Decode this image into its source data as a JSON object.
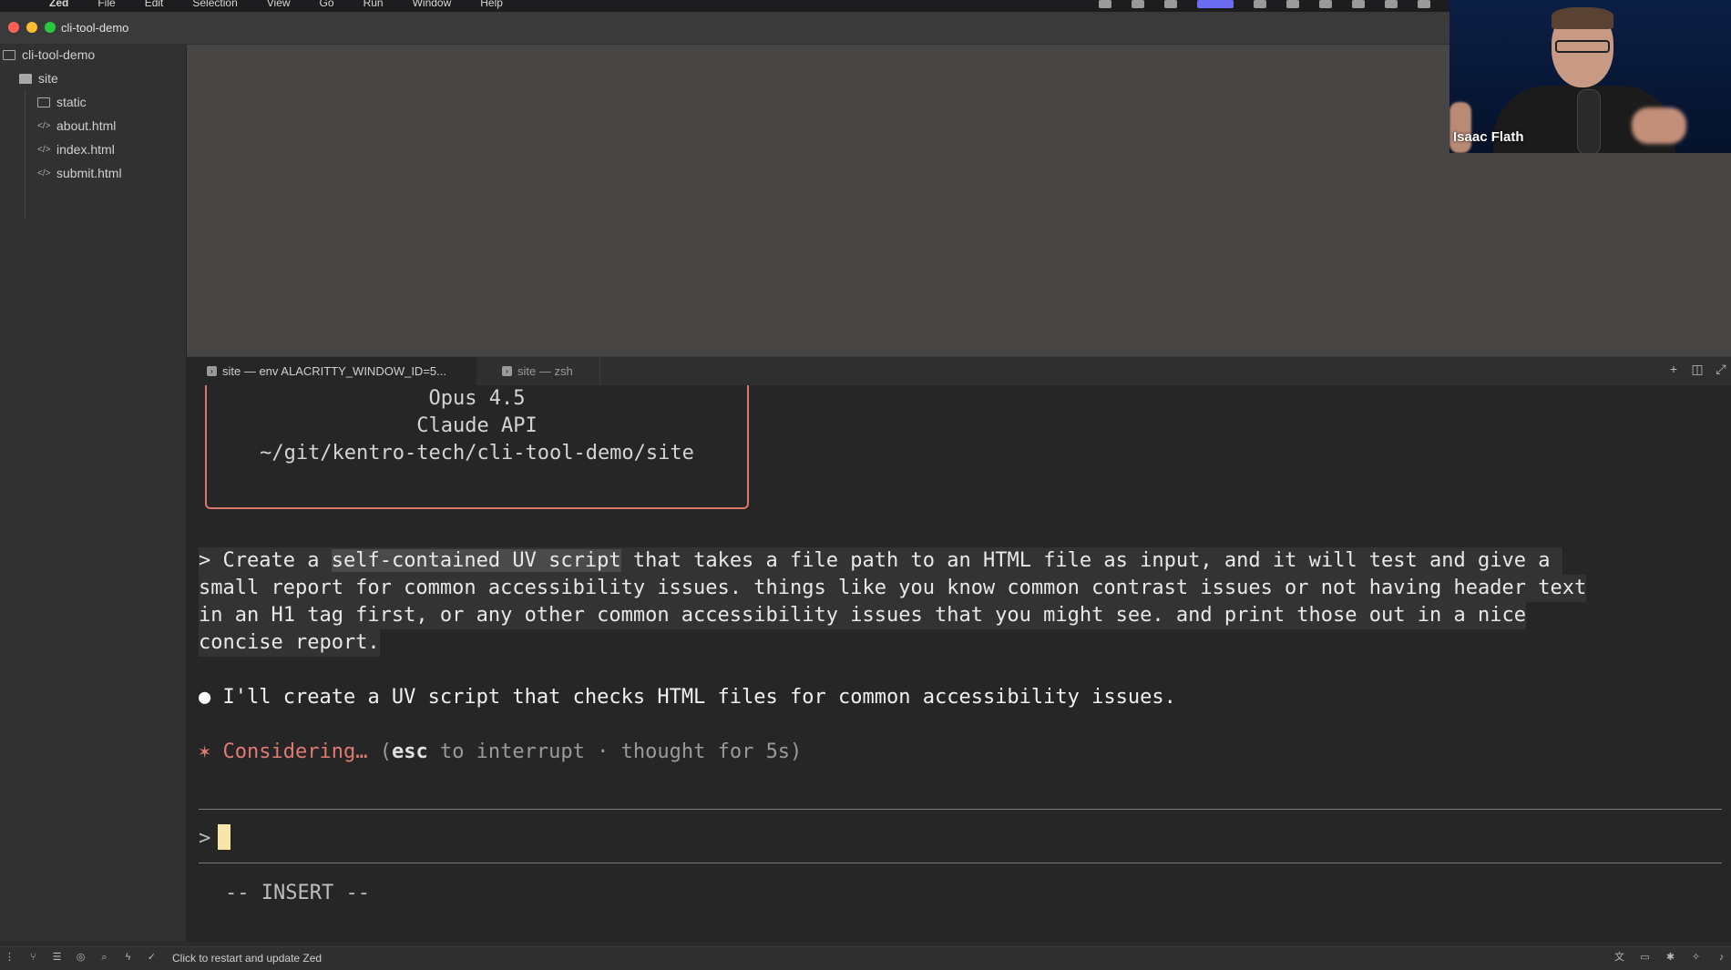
{
  "menubar": {
    "items": [
      "Zed",
      "File",
      "Edit",
      "Selection",
      "View",
      "Go",
      "Run",
      "Window",
      "Help"
    ]
  },
  "window": {
    "title": "cli-tool-demo"
  },
  "sidebar": {
    "root": "cli-tool-demo",
    "items": [
      {
        "label": "site",
        "icon": "folder-open-icon"
      },
      {
        "label": "static",
        "icon": "folder-icon"
      },
      {
        "label": "about.html",
        "icon": "code-icon"
      },
      {
        "label": "index.html",
        "icon": "code-icon"
      },
      {
        "label": "submit.html",
        "icon": "code-icon"
      }
    ]
  },
  "terminal_tabs": [
    {
      "label": "site — env ALACRITTY_WINDOW_ID=5...",
      "active": true
    },
    {
      "label": "site — zsh",
      "active": false
    }
  ],
  "terminal": {
    "banner": {
      "model": "Opus 4.5",
      "api": "Claude API",
      "path": "~/git/kentro-tech/cli-tool-demo/site"
    },
    "prompt": {
      "marker": ">",
      "pre": "Create a ",
      "highlight": "self-contained UV script",
      "line1_rest": " that takes a file path to an HTML file as input, and it will test and give a",
      "line2": "small report for common accessibility issues. things like you know common contrast issues or not having header text",
      "line3": "in an H1 tag first, or any other common accessibility issues that you might see. and print those out in a nice",
      "line4": "concise report."
    },
    "reply": {
      "bullet": "●",
      "text": "I'll create a UV script that checks HTML files for common accessibility issues."
    },
    "status": {
      "star": "✶",
      "considering": "Considering…",
      "open": " (",
      "esc": "esc",
      "rest": " to interrupt · thought for 5s)"
    },
    "input_marker": ">",
    "mode": "-- INSERT --"
  },
  "statusbar": {
    "message": "Click to restart and update Zed"
  },
  "webcam": {
    "name": "Isaac Flath"
  },
  "colors": {
    "accent_border": "#d9776b",
    "considering": "#e07a72",
    "cursor": "#f7e6a8"
  }
}
